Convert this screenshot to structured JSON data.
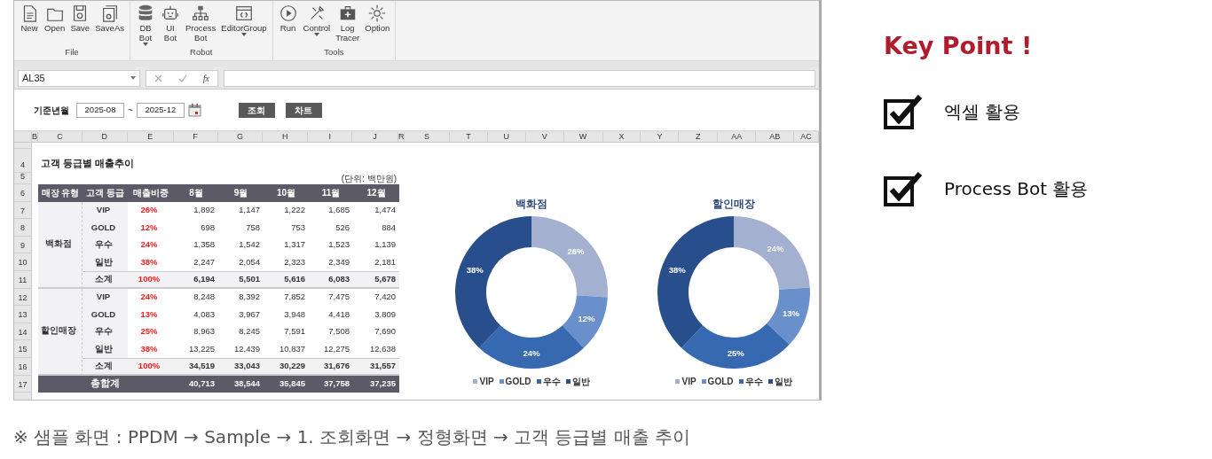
{
  "ribbon": {
    "groups": [
      {
        "label": "File",
        "buttons": [
          {
            "label": "New",
            "dropdown": false
          },
          {
            "label": "Open",
            "dropdown": false
          },
          {
            "label": "Save",
            "dropdown": false
          },
          {
            "label": "SaveAs",
            "dropdown": false
          }
        ]
      },
      {
        "label": "Robot",
        "buttons": [
          {
            "label": "DB Bot",
            "dropdown": true
          },
          {
            "label": "UI Bot",
            "dropdown": false
          },
          {
            "label": "Process Bot",
            "dropdown": false
          },
          {
            "label": "EditorGroup",
            "dropdown": true
          }
        ]
      },
      {
        "label": "Tools",
        "buttons": [
          {
            "label": "Run",
            "dropdown": false
          },
          {
            "label": "Control",
            "dropdown": true
          },
          {
            "label": "Log Tracer",
            "dropdown": false
          },
          {
            "label": "Option",
            "dropdown": false
          }
        ]
      }
    ]
  },
  "formula_bar": {
    "name_box": "AL35",
    "fx": "fx"
  },
  "filter": {
    "label": "기준년월",
    "from": "2025-08",
    "separator": "~",
    "to": "2025-12",
    "buttons": [
      "조회",
      "차트"
    ]
  },
  "sheet": {
    "columns": [
      "B",
      "C",
      "D",
      "E",
      "F",
      "G",
      "H",
      "I",
      "J",
      "R",
      "S",
      "T",
      "U",
      "V",
      "W",
      "X",
      "Y",
      "Z",
      "AA",
      "AB",
      "AC"
    ],
    "rows": [
      "4",
      "5",
      "6",
      "7",
      "8",
      "9",
      "10",
      "11",
      "12",
      "13",
      "14",
      "15",
      "16",
      "17"
    ],
    "title": "고객 등급별 매출추이",
    "unit": "(단위: 백만원)",
    "table": {
      "headers": [
        "매장 유형",
        "고객 등급",
        "매출비중",
        "8월",
        "9월",
        "10월",
        "11월",
        "12월"
      ],
      "groups": [
        {
          "store": "백화점",
          "rows": [
            {
              "grade": "VIP",
              "share": "26%",
              "values": [
                "1,892",
                "1,147",
                "1,222",
                "1,685",
                "1,474"
              ]
            },
            {
              "grade": "GOLD",
              "share": "12%",
              "values": [
                "698",
                "758",
                "753",
                "526",
                "884"
              ]
            },
            {
              "grade": "우수",
              "share": "24%",
              "values": [
                "1,358",
                "1,542",
                "1,317",
                "1,523",
                "1,139"
              ]
            },
            {
              "grade": "일반",
              "share": "38%",
              "values": [
                "2,247",
                "2,054",
                "2,323",
                "2,349",
                "2,181"
              ]
            }
          ],
          "subtotal": {
            "label": "소계",
            "share": "100%",
            "values": [
              "6,194",
              "5,501",
              "5,616",
              "6,083",
              "5,678"
            ]
          }
        },
        {
          "store": "할인매장",
          "rows": [
            {
              "grade": "VIP",
              "share": "24%",
              "values": [
                "8,248",
                "8,392",
                "7,852",
                "7,475",
                "7,420"
              ]
            },
            {
              "grade": "GOLD",
              "share": "13%",
              "values": [
                "4,083",
                "3,967",
                "3,948",
                "4,418",
                "3,809"
              ]
            },
            {
              "grade": "우수",
              "share": "25%",
              "values": [
                "8,963",
                "8,245",
                "7,591",
                "7,508",
                "7,690"
              ]
            },
            {
              "grade": "일반",
              "share": "38%",
              "values": [
                "13,225",
                "12,439",
                "10,837",
                "12,275",
                "12,638"
              ]
            }
          ],
          "subtotal": {
            "label": "소계",
            "share": "100%",
            "values": [
              "34,519",
              "33,043",
              "30,229",
              "31,676",
              "31,557"
            ]
          }
        }
      ],
      "total": {
        "label": "총합계",
        "values": [
          "40,713",
          "38,544",
          "35,845",
          "37,758",
          "37,235"
        ]
      }
    },
    "charts": [
      {
        "chart_data": {
          "type": "donut",
          "title": "백화점",
          "categories": [
            "VIP",
            "GOLD",
            "우수",
            "일반"
          ],
          "values": [
            26,
            12,
            24,
            38
          ],
          "value_labels": [
            "26%",
            "12%",
            "24%",
            "38%"
          ],
          "legend": true
        }
      },
      {
        "chart_data": {
          "type": "donut",
          "title": "할인매장",
          "categories": [
            "VIP",
            "GOLD",
            "우수",
            "일반"
          ],
          "values": [
            24,
            13,
            25,
            38
          ],
          "value_labels": [
            "24%",
            "13%",
            "25%",
            "38%"
          ],
          "legend": true
        }
      }
    ]
  },
  "key_point": {
    "title": "Key Point !",
    "items": [
      {
        "label": "엑셀 활용",
        "checked": true
      },
      {
        "label": "Process Bot 활용",
        "checked": true
      }
    ]
  },
  "caption": "※ 샘플 화면 : PPDM → Sample → 1. 조회화면 → 정형화면 → 고객 등급별 매출 추이"
}
